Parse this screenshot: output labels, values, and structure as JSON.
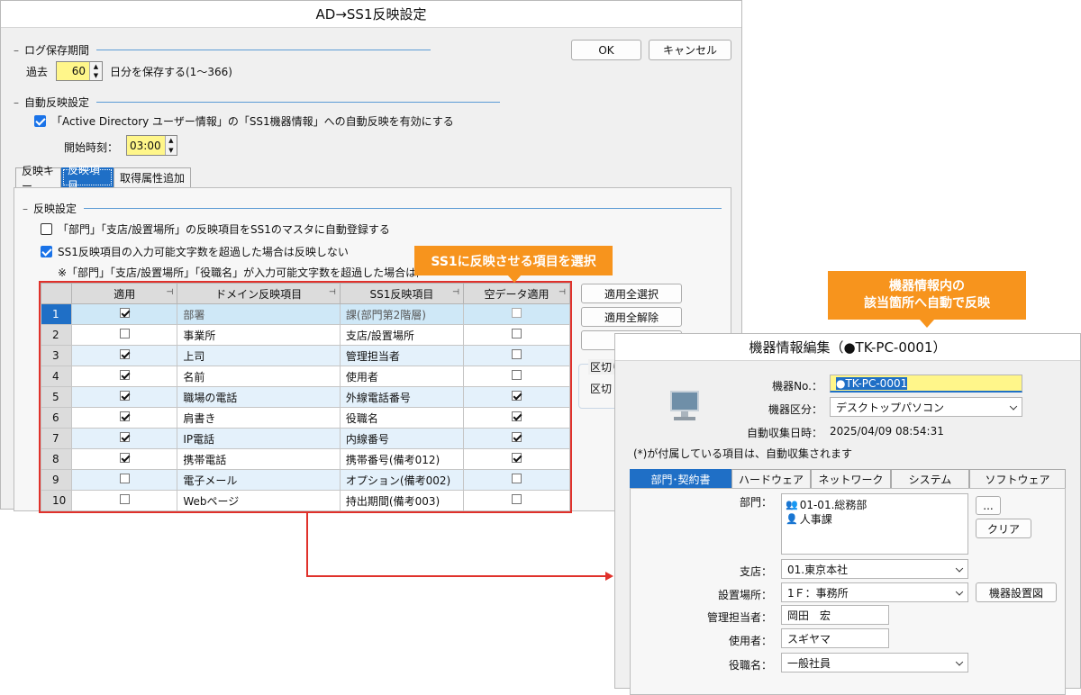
{
  "main_dialog": {
    "title": "AD→SS1反映設定",
    "ok_label": "OK",
    "cancel_label": "キャンセル",
    "log_group": "ログ保存期間",
    "log_prefix": "過去",
    "log_days": "60",
    "log_suffix": "日分を保存する(1〜366)",
    "auto_group": "自動反映設定",
    "auto_enable_label": "「Active Directory ユーザー情報」の「SS1機器情報」への自動反映を有効にする",
    "auto_enable_checked": true,
    "start_time_label": "開始時刻：",
    "start_time": "03:00",
    "tabs": [
      "反映キー",
      "反映項目",
      "取得属性追加"
    ],
    "active_tab": 1,
    "reflect_group": "反映設定",
    "opt1_label": "「部門」「支店/設置場所」の反映項目をSS1のマスタに自動登録する",
    "opt1_checked": false,
    "opt2_label": "SS1反映項目の入力可能文字数を超過した場合は反映しない",
    "opt2_checked": true,
    "note": "※「部門」「支店/設置場所」「役職名」が入力可能文字数を超過した場合は設定",
    "select_all": "適用全選択",
    "deselect_all": "適用全解除",
    "partial_labels": [
      "区切り",
      "区切"
    ],
    "table": {
      "headers": [
        "適用",
        "ドメイン反映項目",
        "SS1反映項目",
        "空データ適用"
      ],
      "rows": [
        {
          "num": "1",
          "apply": true,
          "domain": "部署",
          "ss1": "課(部門第2階層)",
          "empty": false
        },
        {
          "num": "2",
          "apply": false,
          "domain": "事業所",
          "ss1": "支店/設置場所",
          "empty": false
        },
        {
          "num": "3",
          "apply": true,
          "domain": "上司",
          "ss1": "管理担当者",
          "empty": false
        },
        {
          "num": "4",
          "apply": true,
          "domain": "名前",
          "ss1": "使用者",
          "empty": false
        },
        {
          "num": "5",
          "apply": true,
          "domain": "職場の電話",
          "ss1": "外線電話番号",
          "empty": true
        },
        {
          "num": "6",
          "apply": true,
          "domain": "肩書き",
          "ss1": "役職名",
          "empty": true
        },
        {
          "num": "7",
          "apply": true,
          "domain": "IP電話",
          "ss1": "内線番号",
          "empty": true
        },
        {
          "num": "8",
          "apply": true,
          "domain": "携帯電話",
          "ss1": "携帯番号(備考012)",
          "empty": true
        },
        {
          "num": "9",
          "apply": false,
          "domain": "電子メール",
          "ss1": "オプション(備考002)",
          "empty": false
        },
        {
          "num": "10",
          "apply": false,
          "domain": "Webページ",
          "ss1": "持出期間(備考003)",
          "empty": false
        }
      ]
    }
  },
  "callouts": {
    "select_items": "SS1に反映させる項目を選択",
    "auto_reflect_line1": "機器情報内の",
    "auto_reflect_line2": "該当箇所へ自動で反映"
  },
  "device_dialog": {
    "title": "機器情報編集（●TK-PC-0001）",
    "no_label": "機器No.：",
    "no_value": "●TK-PC-0001",
    "type_label": "機器区分：",
    "type_value": "デスクトップパソコン",
    "collected_label": "自動収集日時：",
    "collected_value": "2025/04/09 08:54:31",
    "auto_note": "(*)が付属している項目は、自動収集されます",
    "tabs": [
      "部門･契約書",
      "ハードウェア",
      "ネットワーク",
      "システム",
      "ソフトウェア"
    ],
    "dept_label": "部門：",
    "dept_items": [
      "01-01.総務部",
      "人事課"
    ],
    "more_button": "...",
    "clear_button": "クリア",
    "branch_label": "支店：",
    "branch_value": "01.東京本社",
    "location_label": "設置場所：",
    "location_value": "1Ｆ：事務所",
    "location_button": "機器設置図",
    "manager_label": "管理担当者：",
    "manager_value": "岡田　宏",
    "user_label": "使用者：",
    "user_value": "スギヤマ",
    "position_label": "役職名：",
    "position_value": "一般社員"
  },
  "colors": {
    "callout": "#f7941d",
    "highlight_border": "#e0312b",
    "selection": "#1f6fc6"
  }
}
